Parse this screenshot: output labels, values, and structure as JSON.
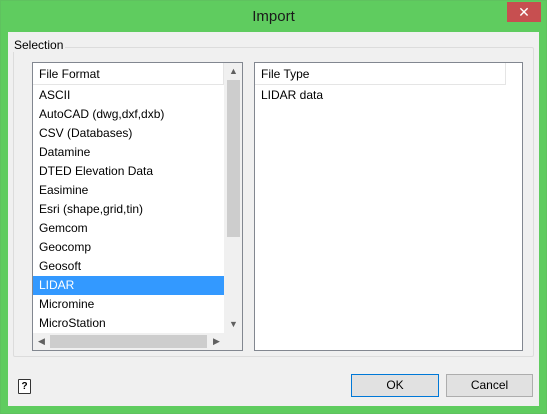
{
  "window": {
    "title": "Import",
    "close_glyph": "✕"
  },
  "selection": {
    "group_title": "Selection",
    "file_format": {
      "header": "File Format",
      "items": [
        "ASCII",
        "AutoCAD (dwg,dxf,dxb)",
        "CSV (Databases)",
        "Datamine",
        "DTED Elevation Data",
        "Easimine",
        "Esri (shape,grid,tin)",
        "Gemcom",
        "Geocomp",
        "Geosoft",
        "LIDAR",
        "Micromine",
        "MicroStation"
      ],
      "selected": "LIDAR"
    },
    "file_type": {
      "header": "File Type",
      "items": [
        "LIDAR data"
      ]
    }
  },
  "scrollbar_glyphs": {
    "up": "▲",
    "down": "▼",
    "left": "◀",
    "right": "▶"
  },
  "footer": {
    "help_glyph": "?",
    "ok_label": "OK",
    "cancel_label": "Cancel"
  },
  "colors": {
    "titlebar": "#5fcc5f",
    "close_button": "#c74f50",
    "selection_highlight": "#3399ff"
  },
  "icons": {
    "help": "help-icon",
    "close": "close-icon"
  }
}
